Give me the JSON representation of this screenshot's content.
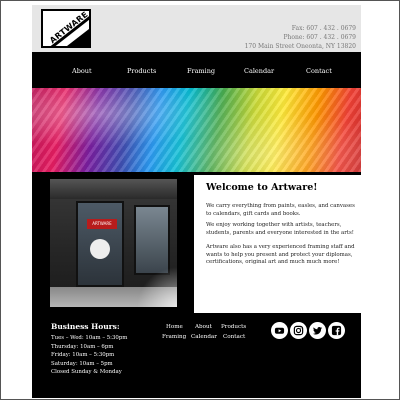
{
  "header": {
    "logo_text": "ARTWARE",
    "fax": "Fax: 607 . 432 . 0679",
    "phone": "Phone: 607 . 432 . 0679",
    "address": "170 Main Street Oneonta, NY 13820"
  },
  "nav": {
    "items": [
      "About",
      "Products",
      "Framing",
      "Calendar",
      "Contact"
    ]
  },
  "banner": {
    "colors": [
      "#c2185b",
      "#3f51b5",
      "#00bcd4",
      "#4caf50",
      "#ffeb3b",
      "#ff9800",
      "#f44336"
    ]
  },
  "photo": {
    "sign_text": "ARTWARE"
  },
  "main": {
    "title": "Welcome to Artware!",
    "paragraphs": [
      "We carry everything from paints, easles, and canvases to calendars, gift cards and books.",
      "We enjoy working together with artists, teachers, students, parents and everyone interested in the arts!",
      "Artware also has a very experienced framing staff and wants to help you present and protect your diplomas, certifications, original art and much much more!"
    ]
  },
  "footer": {
    "hours_title": "Business Hours:",
    "hours": [
      "Tues – Wed: 10am – 5:30pm",
      "Thursday: 10am – 6pm",
      "Friday: 10am – 5:30pm",
      "Saturday: 10am – 5pm",
      "Closed Sunday & Monday"
    ],
    "links_row1": [
      "Home",
      "About",
      "Products"
    ],
    "links_row2": [
      "Framing",
      "Calendar",
      "Contact"
    ],
    "social": [
      "youtube-icon",
      "instagram-icon",
      "twitter-icon",
      "facebook-icon"
    ]
  }
}
